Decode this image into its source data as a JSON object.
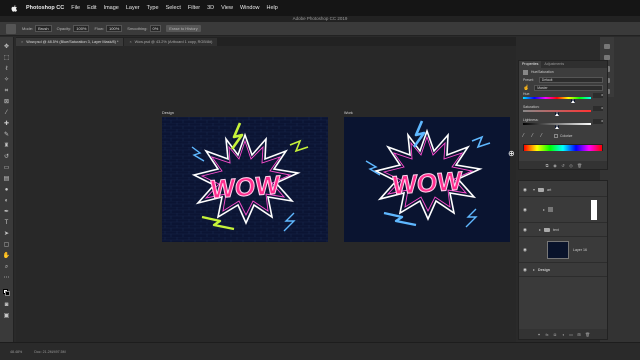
{
  "menubar": {
    "app": "Photoshop CC",
    "items": [
      "File",
      "Edit",
      "Image",
      "Layer",
      "Type",
      "Select",
      "Filter",
      "3D",
      "View",
      "Window",
      "Help"
    ],
    "title": "Adobe Photoshop CC 2019"
  },
  "options": {
    "mode_label": "Mode:",
    "mode_value": "Brush",
    "opacity_label": "Opacity:",
    "opacity_value": "100%",
    "flow_label": "Flow:",
    "flow_value": "100%",
    "smoothing_label": "Smoothing:",
    "smoothing_value": "0%",
    "erase_history": "Erase to History"
  },
  "tabs": [
    {
      "label": "Wow.psd @ 48.5% (Blue/Saturation 3, Layer Mask/8) *",
      "active": true
    },
    {
      "label": "Wow.psd @ 43.2% (Artboard 1 copy, RGB/8#)",
      "active": false
    }
  ],
  "canvas": {
    "artboards": [
      {
        "label": "Design",
        "text": "WOW"
      },
      {
        "label": "Work",
        "text": "WOW"
      }
    ]
  },
  "properties": {
    "tab_properties": "Properties",
    "tab_adjustments": "Adjustments",
    "header": "Hue/Saturation",
    "preset_label": "Preset:",
    "preset_value": "Default",
    "channel_value": "Master",
    "hue_label": "Hue:",
    "hue_value": "0",
    "saturation_label": "Saturation:",
    "saturation_value": "0",
    "lightness_label": "Lightness:",
    "lightness_value": "0",
    "colorize_label": "Colorize",
    "hue_pos": 0.74,
    "sat_pos": 0.5,
    "light_pos": 0.5
  },
  "layers": {
    "rows": [
      {
        "name": "art",
        "type": "folder"
      },
      {
        "name": "",
        "type": "adjustment-mask"
      },
      {
        "name": "text",
        "type": "folder"
      },
      {
        "name": "Layer 16",
        "type": "layer"
      },
      {
        "name": "Design",
        "type": "artboard"
      }
    ]
  },
  "status": {
    "zoom": "48.48%",
    "doc": "Doc: 21.2M/497.5M"
  },
  "colors": {
    "wow_fill": "#ff2f8e",
    "wow_stroke": "#ff7ac4",
    "burst_design": "#c6f23a",
    "burst_work": "#5fb8ff",
    "art_bg": "#0c1530"
  }
}
